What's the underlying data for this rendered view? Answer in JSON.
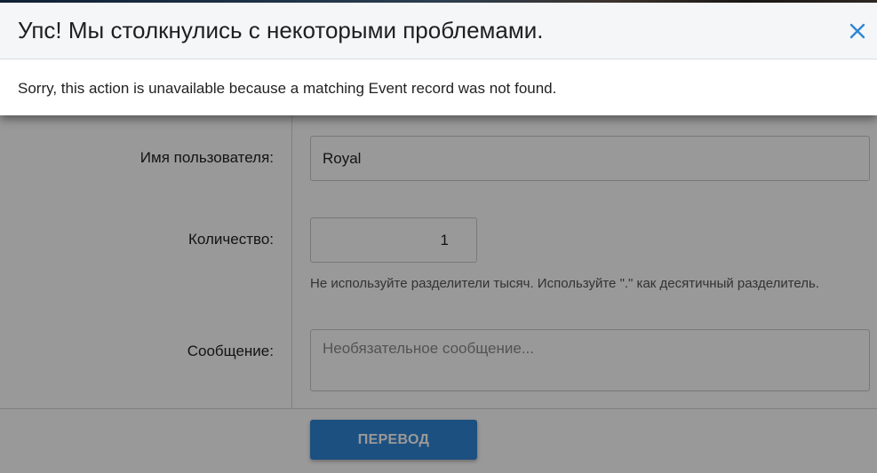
{
  "dialog": {
    "title": "Упс! Мы столкнулись с некоторыми проблемами.",
    "message": "Sorry, this action is unavailable because a matching Event record was not found.",
    "close_icon": "close-icon"
  },
  "form": {
    "username": {
      "label": "Имя пользователя:",
      "value": "Royal"
    },
    "quantity": {
      "label": "Количество:",
      "value": "1",
      "hint": "Не используйте разделители тысяч. Используйте \".\" как десятичный разделитель."
    },
    "message": {
      "label": "Сообщение:",
      "placeholder": "Необязательное сообщение..."
    },
    "submit_label": "ПЕРЕВОД"
  },
  "colors": {
    "accent": "#2f86d6",
    "close_icon": "#2f86d6"
  }
}
